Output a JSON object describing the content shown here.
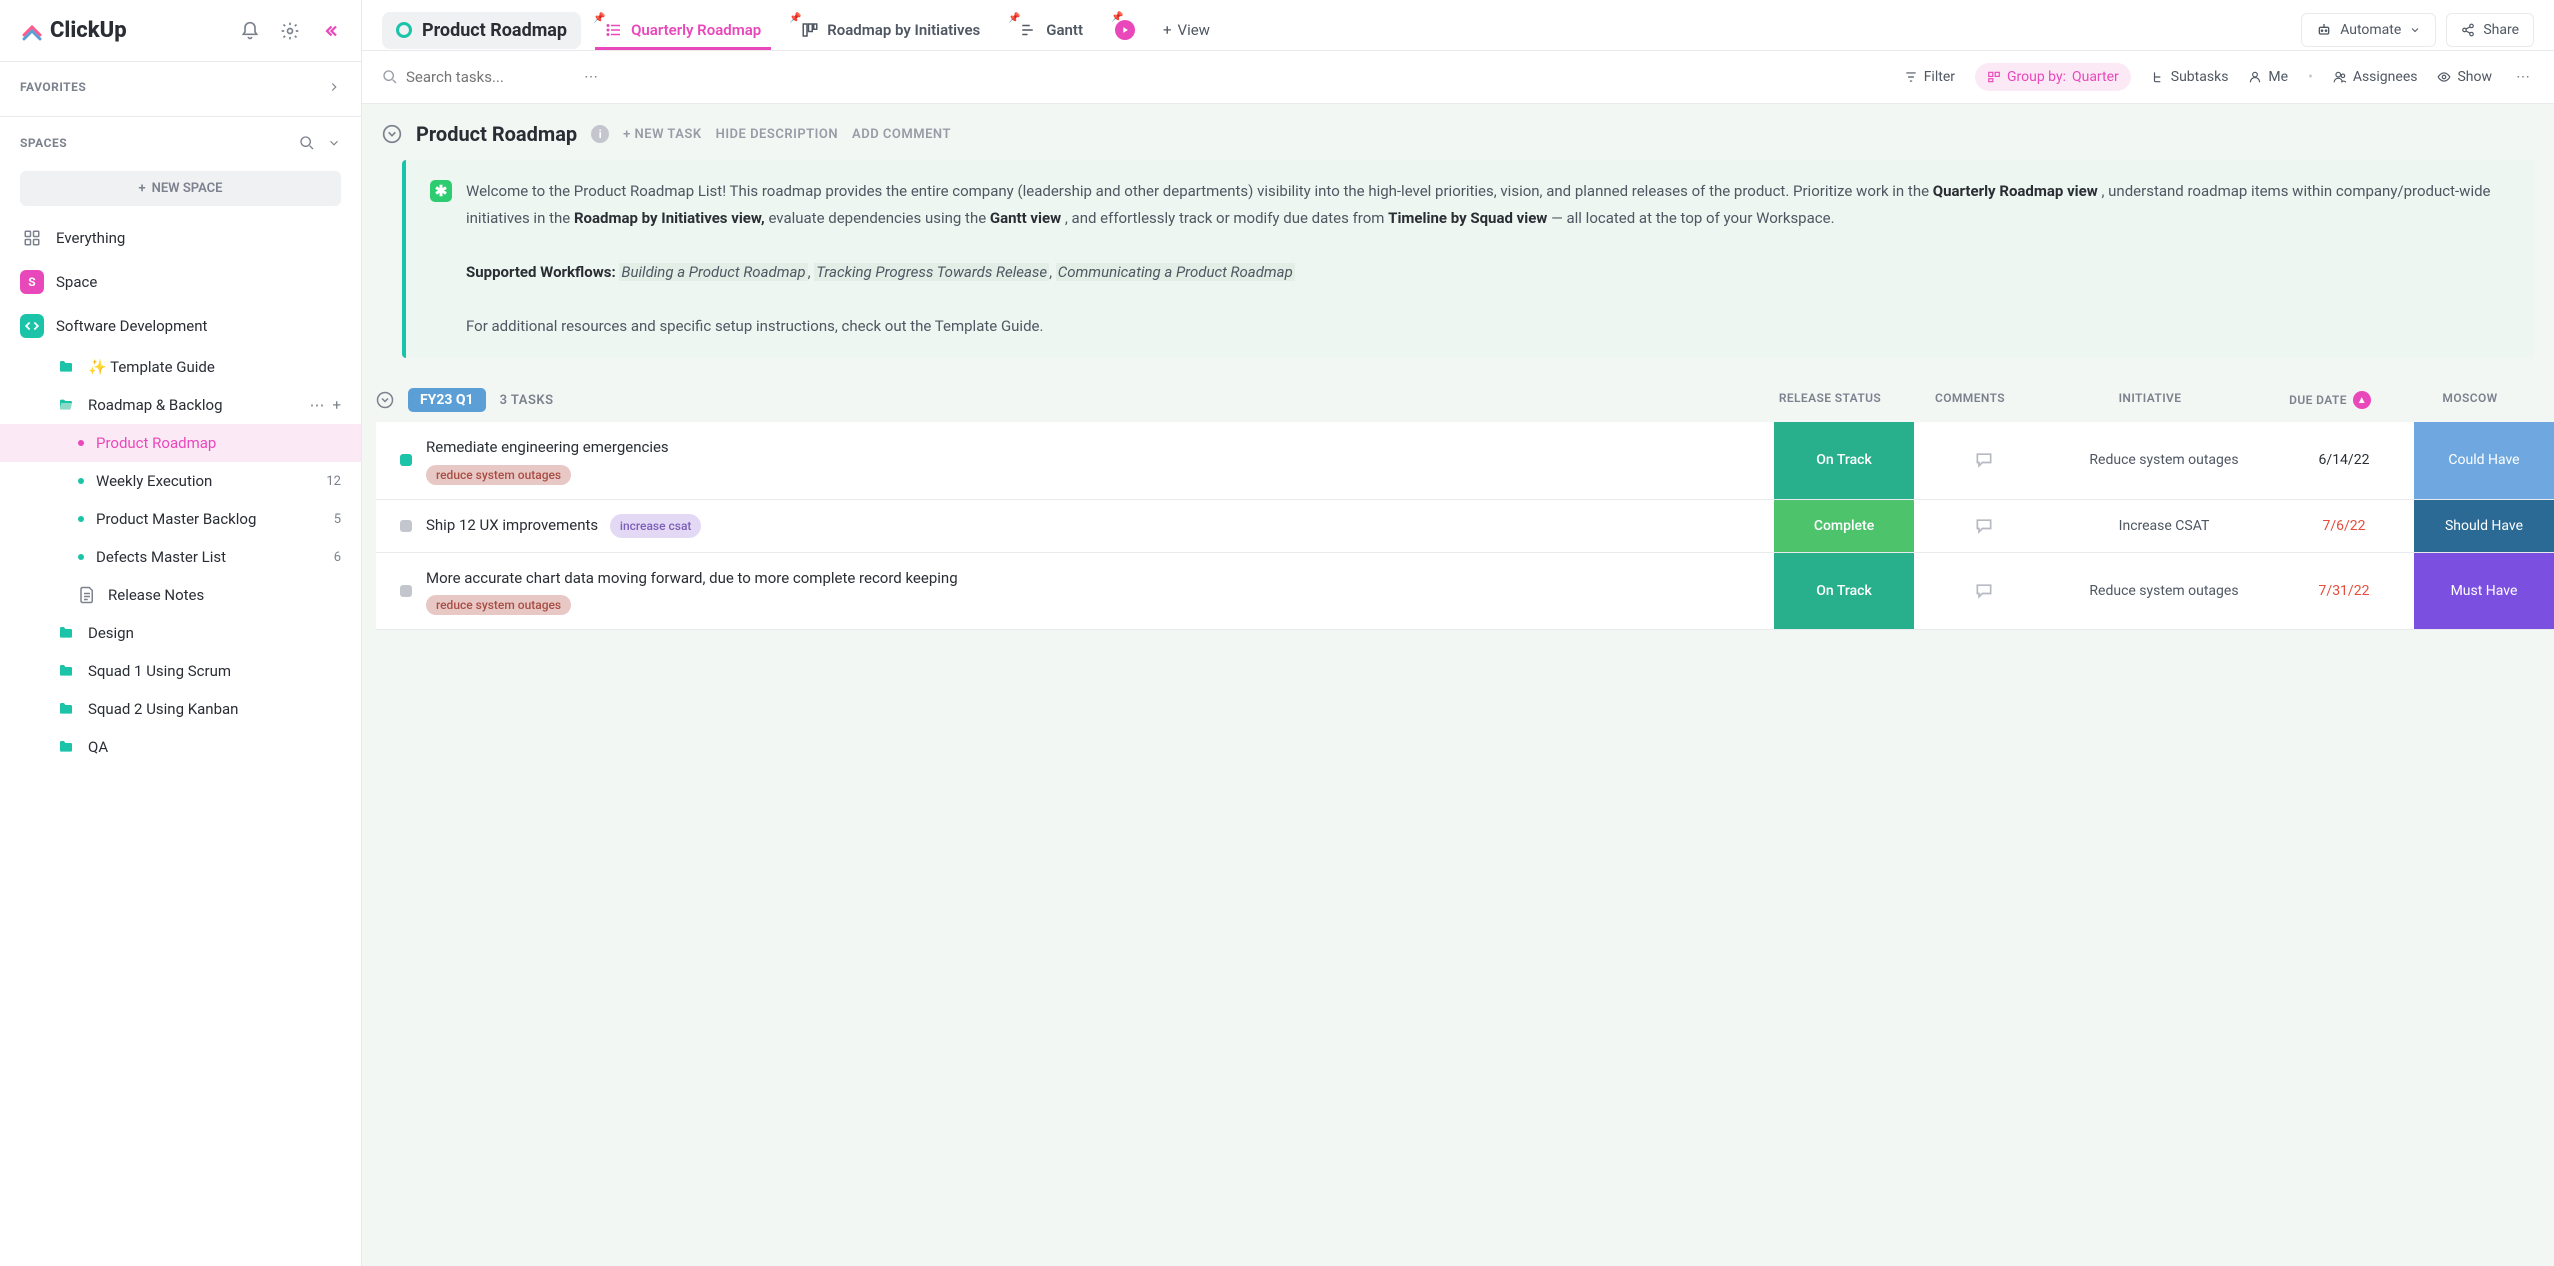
{
  "app": {
    "logo_text": "ClickUp"
  },
  "sidebar": {
    "favorites_label": "FAVORITES",
    "spaces_label": "SPACES",
    "new_space_label": "NEW SPACE",
    "items": [
      {
        "label": "Everything"
      },
      {
        "label": "Space"
      },
      {
        "label": "Software Development"
      }
    ],
    "folders": [
      {
        "label": "✨ Template Guide"
      },
      {
        "label": "Roadmap & Backlog"
      }
    ],
    "lists": [
      {
        "label": "Product Roadmap",
        "count": ""
      },
      {
        "label": "Weekly Execution",
        "count": "12"
      },
      {
        "label": "Product Master Backlog",
        "count": "5"
      },
      {
        "label": "Defects Master List",
        "count": "6"
      }
    ],
    "release_notes": "Release Notes",
    "other_folders": [
      {
        "label": "Design"
      },
      {
        "label": "Squad 1 Using Scrum"
      },
      {
        "label": "Squad 2 Using Kanban"
      },
      {
        "label": "QA"
      }
    ]
  },
  "tabs": {
    "workspace": "Product Roadmap",
    "items": [
      {
        "label": "Quarterly Roadmap"
      },
      {
        "label": "Roadmap by Initiatives"
      },
      {
        "label": "Gantt"
      }
    ],
    "view_label": "View",
    "automate_label": "Automate",
    "share_label": "Share"
  },
  "toolbar": {
    "search_placeholder": "Search tasks...",
    "filter": "Filter",
    "group_label": "Group by:",
    "group_value": "Quarter",
    "subtasks": "Subtasks",
    "me": "Me",
    "assignees": "Assignees",
    "show": "Show"
  },
  "list_header": {
    "title": "Product Roadmap",
    "new_task": "+ NEW TASK",
    "hide_desc": "HIDE DESCRIPTION",
    "add_comment": "ADD COMMENT"
  },
  "description": {
    "intro_a": "Welcome to the Product Roadmap List! This roadmap provides the entire company (leadership and other departments) visibility into the high-level priorities, vision, and planned releases of the product. Prioritize work in the ",
    "b1": "Quarterly Roadmap view",
    "mid1": ", understand roadmap items within company/product-wide initiatives in the ",
    "b2": "Roadmap by Initiatives view,",
    "mid2": " evaluate dependencies using the ",
    "b3": "Gantt view",
    "mid3": ", and effortlessly track or modify due dates from ",
    "b4": "Timeline by Squad view",
    "end": " — all located at the top of your Workspace.",
    "workflows_label": "Supported Workflows",
    "wf1": "Building a Product Roadmap",
    "wf2": "Tracking Progress Towards Release",
    "wf3": "Communicating a Product Roadmap",
    "footer": "For additional resources and specific setup instructions, check out the Template Guide."
  },
  "group": {
    "badge": "FY23 Q1",
    "count": "3 TASKS",
    "columns": {
      "status": "RELEASE STATUS",
      "comments": "COMMENTS",
      "initiative": "INITIATIVE",
      "due": "DUE DATE",
      "moscow": "MOSCOW"
    }
  },
  "tasks": [
    {
      "title": "Remediate engineering emergencies",
      "tag": "reduce system outages",
      "status": "On Track",
      "initiative": "Reduce system outages",
      "due": "6/14/22",
      "moscow": "Could Have"
    },
    {
      "title": "Ship 12 UX improvements",
      "tag": "increase csat",
      "status": "Complete",
      "initiative": "Increase CSAT",
      "due": "7/6/22",
      "moscow": "Should Have"
    },
    {
      "title": "More accurate chart data moving forward, due to more complete record keeping",
      "tag": "reduce system outages",
      "status": "On Track",
      "initiative": "Reduce system outages",
      "due": "7/31/22",
      "moscow": "Must Have"
    }
  ]
}
